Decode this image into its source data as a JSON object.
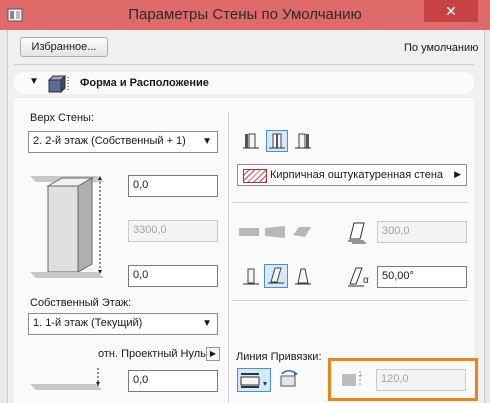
{
  "window": {
    "title": "Параметры Стены по Умолчанию"
  },
  "toolbar": {
    "favorites_button": "Избранное...",
    "default_label": "По умолчанию"
  },
  "section": {
    "title": "Форма и Расположение"
  },
  "geometry": {
    "top_label": "Верх Стены:",
    "top_select": "2. 2-й этаж (Собственный + 1)",
    "top_offset": "0,0",
    "height": "3300,0",
    "bottom_offset": "0,0",
    "home_story_label": "Собственный Этаж:",
    "home_story_select": "1. 1-й этаж (Текущий)",
    "project_zero_label": "отн. Проектный Нуль",
    "base_elevation": "0,0"
  },
  "material": {
    "name": "Кирпичная оштукатуренная стена"
  },
  "thickness": {
    "value": "300,0"
  },
  "slant": {
    "angle": "50,00°"
  },
  "reference_line": {
    "label": "Линия Привязки:",
    "offset": "120,0"
  }
}
